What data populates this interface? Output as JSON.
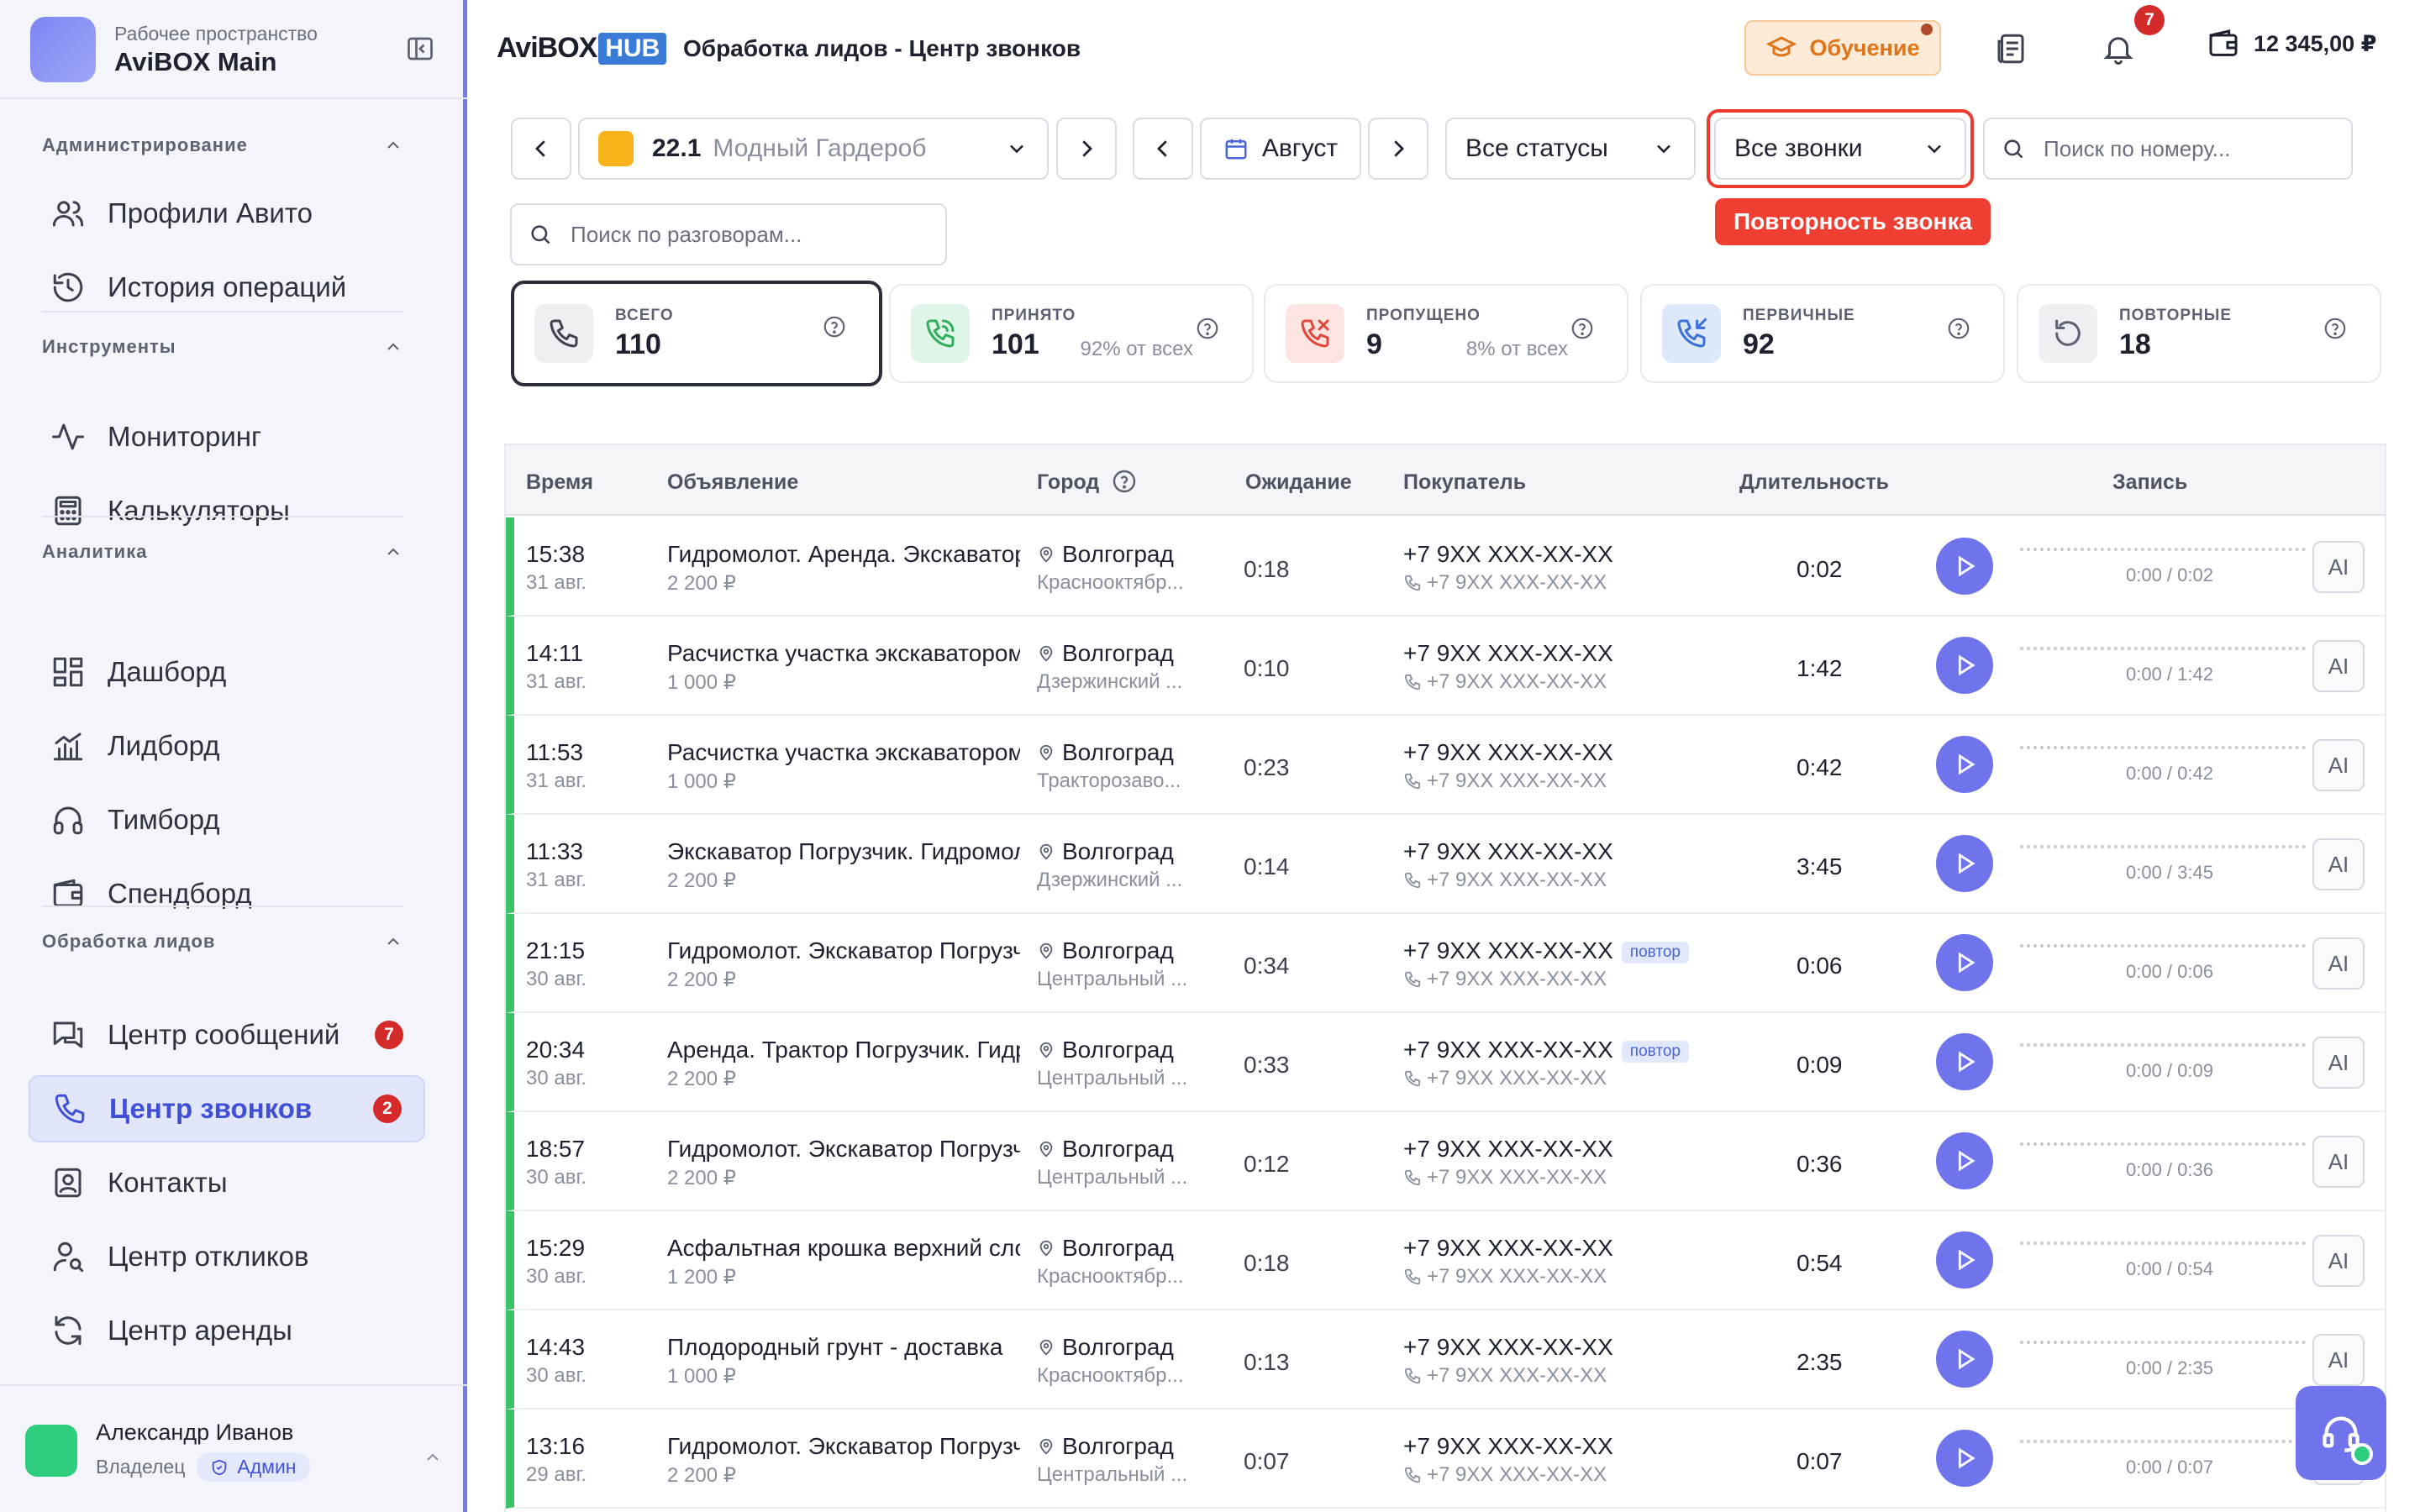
{
  "workspace": {
    "caption": "Рабочее пространство",
    "name": "AviBOX Main"
  },
  "sidebar": {
    "sections": [
      {
        "title": "Администрирование",
        "items": [
          {
            "label": "Профили Авито",
            "icon": "users-icon"
          },
          {
            "label": "История операций",
            "icon": "history-icon"
          }
        ]
      },
      {
        "title": "Инструменты",
        "items": [
          {
            "label": "Мониторинг",
            "icon": "activity-icon"
          },
          {
            "label": "Калькуляторы",
            "icon": "calculator-icon"
          }
        ]
      },
      {
        "title": "Аналитика",
        "items": [
          {
            "label": "Дашборд",
            "icon": "dashboard-icon"
          },
          {
            "label": "Лидборд",
            "icon": "chart-icon"
          },
          {
            "label": "Тимборд",
            "icon": "headphones-icon"
          },
          {
            "label": "Спендборд",
            "icon": "wallet-icon"
          }
        ]
      },
      {
        "title": "Обработка лидов",
        "items": [
          {
            "label": "Центр сообщений",
            "icon": "messages-icon",
            "badge": "7"
          },
          {
            "label": "Центр звонков",
            "icon": "phone-icon",
            "badge": "2",
            "active": true
          },
          {
            "label": "Контакты",
            "icon": "contacts-icon"
          },
          {
            "label": "Центр откликов",
            "icon": "user-search-icon"
          },
          {
            "label": "Центр аренды",
            "icon": "refresh-icon"
          }
        ]
      }
    ]
  },
  "user": {
    "name": "Александр Иванов",
    "role": "Владелец",
    "badge": "Админ"
  },
  "header": {
    "logo_a": "AviBOX",
    "logo_hub": "HUB",
    "title": "Обработка лидов - Центр звонков",
    "learn_label": "Обучение",
    "notif_count": "7",
    "balance": "12 345,00 ₽"
  },
  "filters": {
    "profile_num": "22.1",
    "profile_name": "Модный Гардероб",
    "month": "Август",
    "status": "Все статусы",
    "calls": "Все звонки",
    "phone_search_placeholder": "Поиск по номеру...",
    "talk_search_placeholder": "Поиск по разговорам...",
    "tooltip": "Повторность звонка"
  },
  "stats": [
    {
      "label": "ВСЕГО",
      "value": "110",
      "sub": ""
    },
    {
      "label": "ПРИНЯТО",
      "value": "101",
      "sub": "92% от всех"
    },
    {
      "label": "ПРОПУЩЕНО",
      "value": "9",
      "sub": "8% от всех"
    },
    {
      "label": "ПЕРВИЧНЫЕ",
      "value": "92",
      "sub": ""
    },
    {
      "label": "ПОВТОРНЫЕ",
      "value": "18",
      "sub": ""
    }
  ],
  "table": {
    "columns": [
      "Время",
      "Объявление",
      "Город",
      "Ожидание",
      "Покупатель",
      "Длительность",
      "Запись"
    ],
    "repeat_label": "повтор",
    "ai_label": "AI",
    "rows": [
      {
        "time": "15:38",
        "date": "31 авг.",
        "ad": "Гидромолот. Аренда. Экскаватор",
        "price": "2 200 ₽",
        "city": "Волгоград",
        "district": "Краснооктябр...",
        "wait": "0:18",
        "buyer": "+7 9XX XXX-XX-XX",
        "buyer2": "+7 9XX XXX-XX-XX",
        "repeat": false,
        "duration": "0:02",
        "rec": "0:00 / 0:02"
      },
      {
        "time": "14:11",
        "date": "31 авг.",
        "ad": "Расчистка участка экскаватором",
        "price": "1 000 ₽",
        "city": "Волгоград",
        "district": "Дзержинский ...",
        "wait": "0:10",
        "buyer": "+7 9XX XXX-XX-XX",
        "buyer2": "+7 9XX XXX-XX-XX",
        "repeat": false,
        "duration": "1:42",
        "rec": "0:00 / 1:42"
      },
      {
        "time": "11:53",
        "date": "31 авг.",
        "ad": "Расчистка участка экскаватором",
        "price": "1 000 ₽",
        "city": "Волгоград",
        "district": "Тракторозаво...",
        "wait": "0:23",
        "buyer": "+7 9XX XXX-XX-XX",
        "buyer2": "+7 9XX XXX-XX-XX",
        "repeat": false,
        "duration": "0:42",
        "rec": "0:00 / 0:42"
      },
      {
        "time": "11:33",
        "date": "31 авг.",
        "ad": "Экскаватор Погрузчик. Гидромолот",
        "price": "2 200 ₽",
        "city": "Волгоград",
        "district": "Дзержинский ...",
        "wait": "0:14",
        "buyer": "+7 9XX XXX-XX-XX",
        "buyer2": "+7 9XX XXX-XX-XX",
        "repeat": false,
        "duration": "3:45",
        "rec": "0:00 / 3:45"
      },
      {
        "time": "21:15",
        "date": "30 авг.",
        "ad": "Гидромолот. Экскаватор Погрузчик",
        "price": "2 200 ₽",
        "city": "Волгоград",
        "district": "Центральный ...",
        "wait": "0:34",
        "buyer": "+7 9XX XXX-XX-XX",
        "buyer2": "+7 9XX XXX-XX-XX",
        "repeat": true,
        "duration": "0:06",
        "rec": "0:00 / 0:06"
      },
      {
        "time": "20:34",
        "date": "30 авг.",
        "ad": "Аренда. Трактор Погрузчик. Гидромолот",
        "price": "2 200 ₽",
        "city": "Волгоград",
        "district": "Центральный ...",
        "wait": "0:33",
        "buyer": "+7 9XX XXX-XX-XX",
        "buyer2": "+7 9XX XXX-XX-XX",
        "repeat": true,
        "duration": "0:09",
        "rec": "0:00 / 0:09"
      },
      {
        "time": "18:57",
        "date": "30 авг.",
        "ad": "Гидромолот. Экскаватор Погрузчик",
        "price": "2 200 ₽",
        "city": "Волгоград",
        "district": "Центральный ...",
        "wait": "0:12",
        "buyer": "+7 9XX XXX-XX-XX",
        "buyer2": "+7 9XX XXX-XX-XX",
        "repeat": false,
        "duration": "0:36",
        "rec": "0:00 / 0:36"
      },
      {
        "time": "15:29",
        "date": "30 авг.",
        "ad": "Асфальтная крошка верхний слой",
        "price": "1 200 ₽",
        "city": "Волгоград",
        "district": "Краснооктябр...",
        "wait": "0:18",
        "buyer": "+7 9XX XXX-XX-XX",
        "buyer2": "+7 9XX XXX-XX-XX",
        "repeat": false,
        "duration": "0:54",
        "rec": "0:00 / 0:54"
      },
      {
        "time": "14:43",
        "date": "30 авг.",
        "ad": "Плодородный грунт - доставка",
        "price": "1 000 ₽",
        "city": "Волгоград",
        "district": "Краснооктябр...",
        "wait": "0:13",
        "buyer": "+7 9XX XXX-XX-XX",
        "buyer2": "+7 9XX XXX-XX-XX",
        "repeat": false,
        "duration": "2:35",
        "rec": "0:00 / 2:35"
      },
      {
        "time": "13:16",
        "date": "29 авг.",
        "ad": "Гидромолот. Экскаватор Погрузчик",
        "price": "2 200 ₽",
        "city": "Волгоград",
        "district": "Центральный ...",
        "wait": "0:07",
        "buyer": "+7 9XX XXX-XX-XX",
        "buyer2": "+7 9XX XXX-XX-XX",
        "repeat": false,
        "duration": "0:07",
        "rec": "0:00 / 0:07"
      }
    ]
  },
  "colors": {
    "accent": "#6f74ec",
    "accepted": "#3cc36a",
    "missed": "#ef3f32",
    "learn": "#e07418"
  }
}
